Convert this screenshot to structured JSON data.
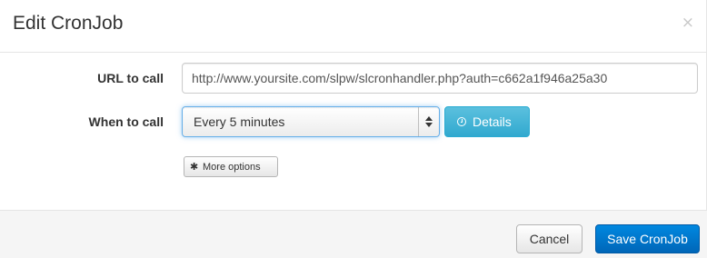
{
  "dialog": {
    "title": "Edit CronJob",
    "close_glyph": "×"
  },
  "form": {
    "url_label": "URL to call",
    "url_value": "http://www.yoursite.com/slpw/slcronhandler.php?auth=c662a1f946a25a30",
    "when_label": "When to call",
    "interval_selected": "Every 5 minutes",
    "details_label": "Details",
    "details_icon": "clock-icon",
    "more_options_label": "More options",
    "more_options_icon": "gear-icon"
  },
  "footer": {
    "cancel_label": "Cancel",
    "save_label": "Save CronJob"
  },
  "colors": {
    "primary": "#0077cc",
    "info": "#5bc0de"
  }
}
